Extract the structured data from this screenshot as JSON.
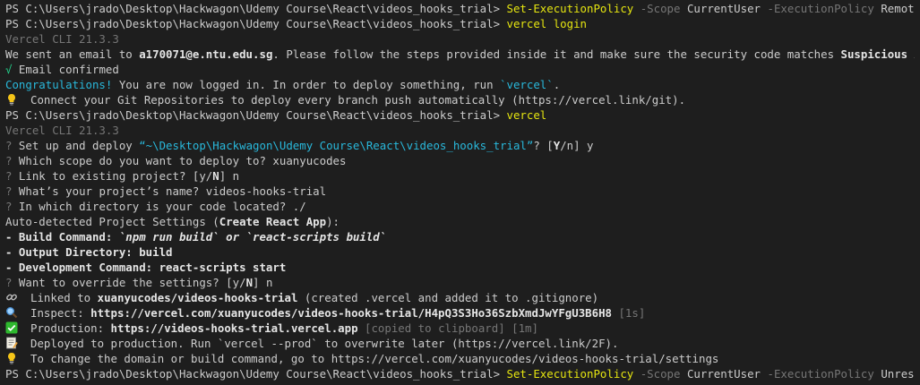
{
  "terminal": {
    "prompt": "PS C:\\Users\\jrado\\Desktop\\Hackwagon\\Udemy Course\\React\\videos_hooks_trial>",
    "cmd1": {
      "name": "Set-ExecutionPolicy",
      "flag1": "-Scope",
      "val1": "CurrentUser",
      "flag2": "-ExecutionPolicy",
      "val2": "RemoteSigned"
    },
    "cmd2": "vercel login",
    "cli_version": "Vercel CLI 21.3.3",
    "email_pre": "We sent an email to ",
    "email": "a170071@e.ntu.edu.sg",
    "email_mid": ". Please follow the steps provided inside it and make sure the security code matches ",
    "security_code": "Suspicious Avocet",
    "email_end": ".",
    "confirmed_check": "√",
    "confirmed": " Email confirmed",
    "congrats": "Congratulations!",
    "congrats_rest_pre": " You are now logged in. In order to deploy something, run ",
    "congrats_cmd": "`vercel`",
    "congrats_end": ".",
    "tip1": "Connect your Git Repositories to deploy every branch push automatically (https://vercel.link/git).",
    "cmd3": "vercel",
    "q_mark": "?",
    "q1_pre": " Set up and deploy ",
    "q1_path": "“~\\Desktop\\Hackwagon\\Udemy Course\\React\\videos_hooks_trial”",
    "q1_opts_pre": "? [",
    "q1_opts_y": "Y",
    "q1_opts_post": "/n] y",
    "q2": " Which scope do you want to deploy to? xuanyucodes",
    "q3_pre": " Link to existing project? [y/",
    "q3_N": "N",
    "q3_post": "] n",
    "q4": " What’s your project’s name? videos-hooks-trial",
    "q5": " In which directory is your code located? ./",
    "auto_pre": "Auto-detected Project Settings (",
    "auto_app": "Create React App",
    "auto_post": "):",
    "build_label": "- Build Command: ",
    "build_val": "`npm run build` or `react-scripts build`",
    "output_label": "- Output Directory: ",
    "output_val": "build",
    "dev_label": "- Development Command: ",
    "dev_val": "react-scripts start",
    "q6_pre": " Want to override the settings? [y/",
    "q6_N": "N",
    "q6_post": "] n",
    "linked_pre": "Linked to ",
    "linked_proj": "xuanyucodes/videos-hooks-trial",
    "linked_post": " (created .vercel and added it to .gitignore)",
    "inspect_pre": "Inspect: ",
    "inspect_url": "https://vercel.com/xuanyucodes/videos-hooks-trial/H4pQ3S3Ho36SzbXmdJwYFgU3B6H8",
    "inspect_time": " [1s]",
    "prod_pre": "Production: ",
    "prod_url": "https://videos-hooks-trial.vercel.app",
    "prod_clip": " [copied to clipboard]",
    "prod_time": " [1m]",
    "deployed": "Deployed to production. Run `vercel --prod` to overwrite later (https://vercel.link/2F).",
    "tip2": "To change the domain or build command, go to https://vercel.com/xuanyucodes/videos-hooks-trial/settings",
    "cmd_last": {
      "name": "Set-ExecutionPolicy",
      "flag1": "-Scope",
      "val1": "CurrentUser",
      "flag2": "-ExecutionPolicy",
      "val2": "Unrestricted"
    }
  },
  "colors": {
    "background": "#1e1e1e",
    "text": "#cccccc",
    "command": "#e5e510",
    "success": "#23d18b",
    "info": "#29b8db",
    "muted": "#767676"
  },
  "icons": [
    "lightbulb-icon",
    "link-icon",
    "magnifier-icon",
    "check-box-icon",
    "memo-icon"
  ]
}
